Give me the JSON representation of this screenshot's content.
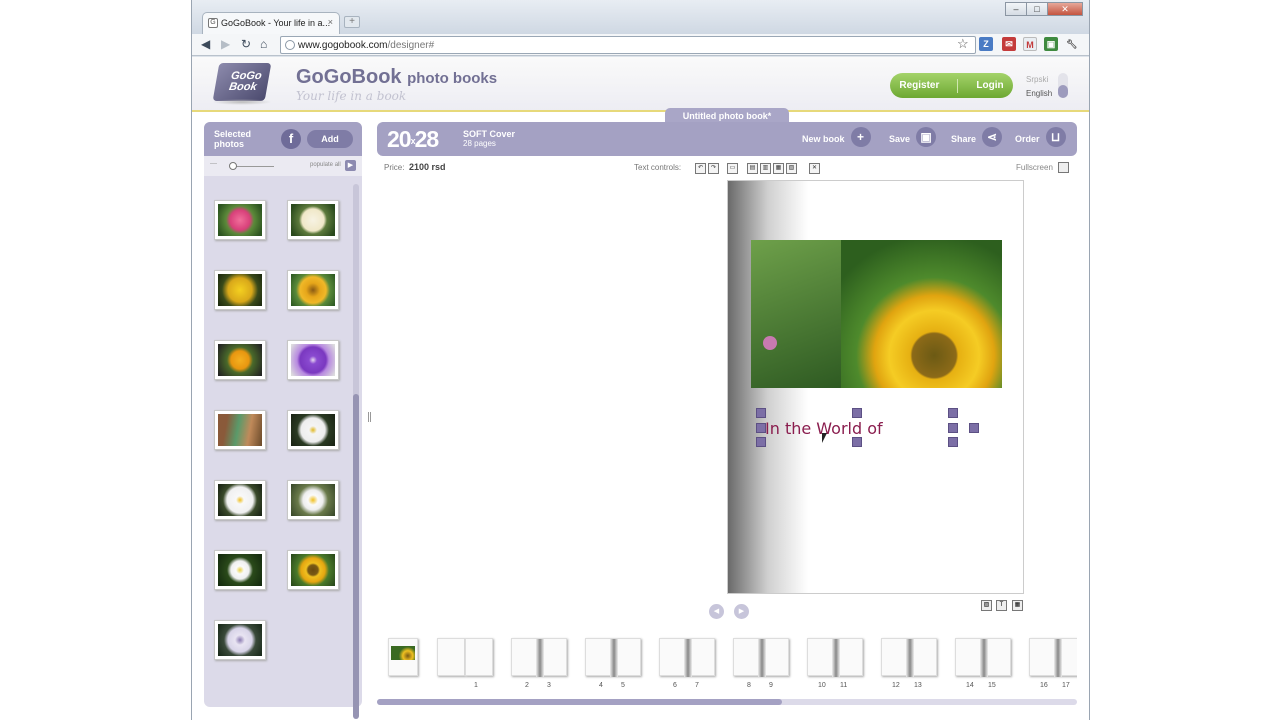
{
  "browser": {
    "tab_title": "GoGoBook - Your life in a...",
    "tab_close": "×",
    "new_tab": "+",
    "url_host": "www.gogobook.com",
    "url_path": "/designer#",
    "window_buttons": [
      "–",
      "□",
      "✕"
    ]
  },
  "site": {
    "brand_name": "GoGoBook",
    "brand_suffix": "photo books",
    "tagline": "Your life in a book",
    "logo_text_1": "GoGo",
    "logo_text_2": "Book",
    "register_label": "Register",
    "login_label": "Login",
    "lang_inactive": "Srpski",
    "lang_active": "English",
    "book_title": "Untitled photo book*"
  },
  "left_panel": {
    "title_line1": "Selected",
    "title_line2": "photos",
    "facebook_label": "f",
    "add_label": "Add",
    "populate_label": "populate all",
    "photo_count": 13
  },
  "main_bar": {
    "size_w": "20",
    "size_x": "x",
    "size_h": "28",
    "cover": "SOFT Cover",
    "pages": "28 pages",
    "new_book": "New book",
    "save": "Save",
    "share": "Share",
    "order": "Order"
  },
  "price_bar": {
    "price_label": "Price:",
    "price_value": "2100 rsd",
    "text_controls_label": "Text controls:",
    "fullscreen_label": "Fullscreen"
  },
  "canvas": {
    "text_content": "In the World of"
  },
  "filmstrip": {
    "page_numbers": [
      "1",
      "2",
      "3",
      "4",
      "5",
      "6",
      "7",
      "8",
      "9",
      "10",
      "11",
      "12",
      "13",
      "14",
      "15",
      "16",
      "17"
    ]
  },
  "colors": {
    "panel_purple": "#a4a1c3",
    "accent_green": "#7cb842",
    "text_magenta": "#8a1d4e"
  }
}
